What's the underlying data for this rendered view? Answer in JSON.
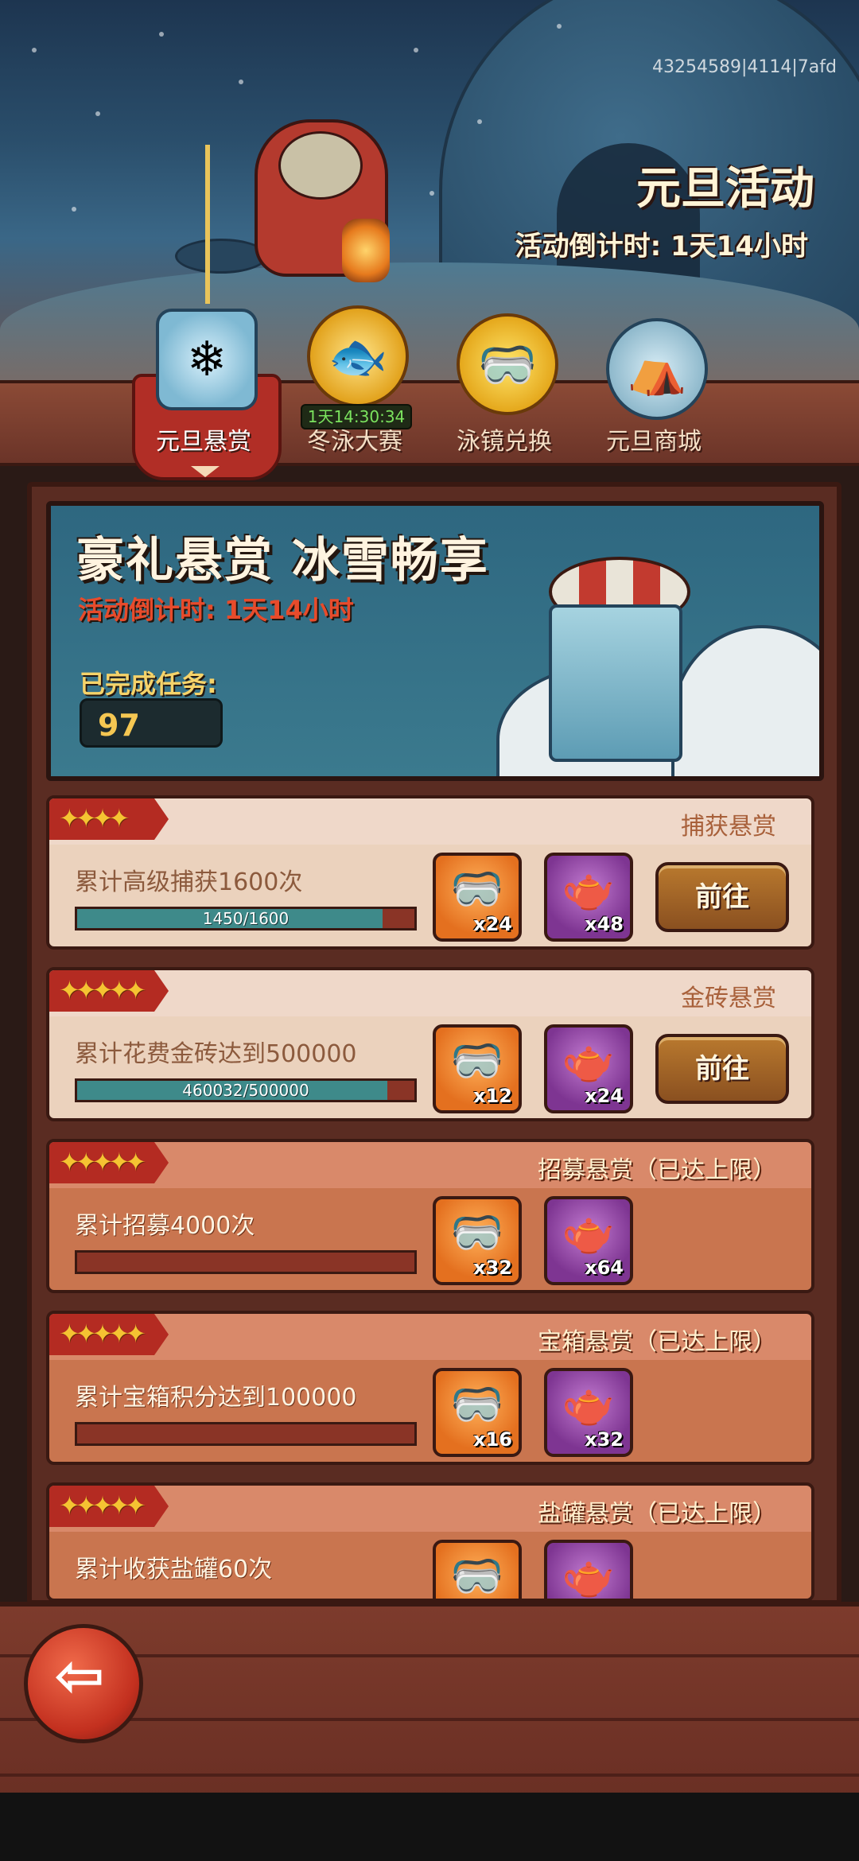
{
  "header": {
    "event_title": "元旦活动",
    "event_countdown": "活动倒计时: 1天14小时",
    "debug_id": "43254589|4114|7afd"
  },
  "tabs": [
    {
      "label": "元旦悬赏",
      "active": true,
      "icon": "ice-trophy-icon"
    },
    {
      "label": "冬泳大赛",
      "active": false,
      "icon": "gold-fish-icon",
      "timer": "1天14:30:34"
    },
    {
      "label": "泳镜兑换",
      "active": false,
      "icon": "goggles-icon"
    },
    {
      "label": "元旦商城",
      "active": false,
      "icon": "igloo-icon"
    }
  ],
  "banner": {
    "title": "豪礼悬赏 冰雪畅享",
    "countdown": "活动倒计时: 1天14小时",
    "completed_label": "已完成任务:",
    "completed_value": "97"
  },
  "tasks": [
    {
      "type": "捕获悬赏",
      "stars": "✦✦✦✦",
      "desc": "累计高级捕获1600次",
      "progress_text": "1450/1600",
      "progress": 0.906,
      "reward1_qty": "x24",
      "reward2_qty": "x48",
      "button": "前往",
      "state": "active"
    },
    {
      "type": "金砖悬赏",
      "stars": "✦✦✦✦✦",
      "desc": "累计花费金砖达到500000",
      "progress_text": "460032/500000",
      "progress": 0.92,
      "reward1_qty": "x12",
      "reward2_qty": "x24",
      "button": "前往",
      "state": "active"
    },
    {
      "type": "招募悬赏（已达上限）",
      "stars": "✦✦✦✦✦",
      "desc": "累计招募4000次",
      "progress_text": "",
      "progress": 0,
      "reward1_qty": "x32",
      "reward2_qty": "x64",
      "state": "done"
    },
    {
      "type": "宝箱悬赏（已达上限）",
      "stars": "✦✦✦✦✦",
      "desc": "累计宝箱积分达到100000",
      "progress_text": "",
      "progress": 0,
      "reward1_qty": "x16",
      "reward2_qty": "x32",
      "state": "done"
    },
    {
      "type": "盐罐悬赏（已达上限）",
      "stars": "✦✦✦✦✦",
      "desc": "累计收获盐罐60次",
      "progress_text": "",
      "progress": 0,
      "reward1_qty": "",
      "reward2_qty": "",
      "state": "done"
    }
  ],
  "colors": {
    "accent_red": "#b42b22",
    "progress_teal": "#3e8a8a",
    "timer_green": "#7be35e",
    "gold": "#f5c332"
  }
}
